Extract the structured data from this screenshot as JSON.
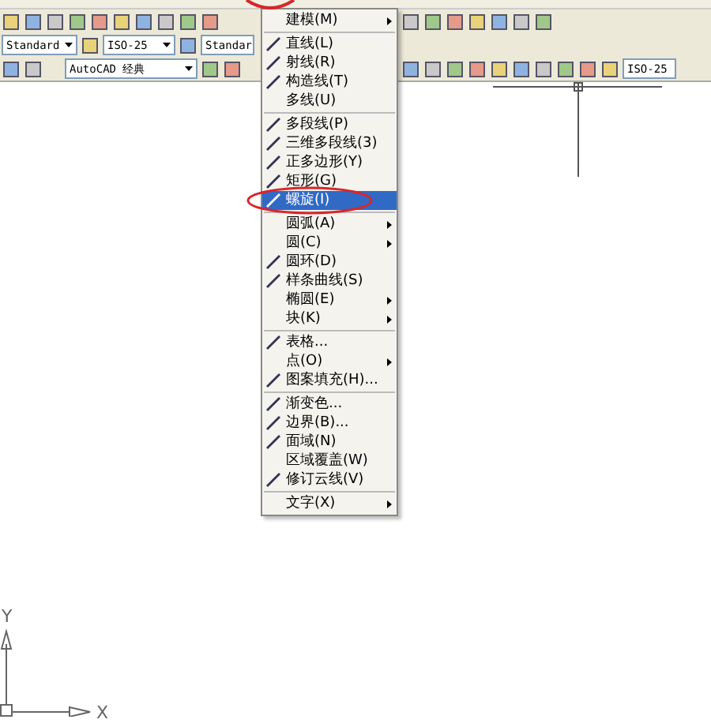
{
  "toolbars": {
    "style_combos": [
      {
        "value": "Standard"
      },
      {
        "value": "ISO-25"
      },
      {
        "value": "Standar"
      }
    ],
    "workspace_combo": {
      "value": "AutoCAD 经典"
    },
    "dimstyle_combo": {
      "value": "ISO-25"
    }
  },
  "draw_menu": {
    "items": [
      {
        "kind": "item",
        "label": "建模(M)",
        "submenu": true,
        "icon": false,
        "selected": false
      },
      {
        "kind": "separator"
      },
      {
        "kind": "item",
        "label": "直线(L)",
        "submenu": false,
        "icon": true,
        "selected": false
      },
      {
        "kind": "item",
        "label": "射线(R)",
        "submenu": false,
        "icon": true,
        "selected": false
      },
      {
        "kind": "item",
        "label": "构造线(T)",
        "submenu": false,
        "icon": true,
        "selected": false
      },
      {
        "kind": "item",
        "label": "多线(U)",
        "submenu": false,
        "icon": false,
        "selected": false
      },
      {
        "kind": "separator"
      },
      {
        "kind": "item",
        "label": "多段线(P)",
        "submenu": false,
        "icon": true,
        "selected": false
      },
      {
        "kind": "item",
        "label": "三维多段线(3)",
        "submenu": false,
        "icon": true,
        "selected": false
      },
      {
        "kind": "item",
        "label": "正多边形(Y)",
        "submenu": false,
        "icon": true,
        "selected": false
      },
      {
        "kind": "item",
        "label": "矩形(G)",
        "submenu": false,
        "icon": true,
        "selected": false
      },
      {
        "kind": "item",
        "label": "螺旋(I)",
        "submenu": false,
        "icon": true,
        "selected": true
      },
      {
        "kind": "separator"
      },
      {
        "kind": "item",
        "label": "圆弧(A)",
        "submenu": true,
        "icon": false,
        "selected": false
      },
      {
        "kind": "item",
        "label": "圆(C)",
        "submenu": true,
        "icon": false,
        "selected": false
      },
      {
        "kind": "item",
        "label": "圆环(D)",
        "submenu": false,
        "icon": true,
        "selected": false
      },
      {
        "kind": "item",
        "label": "样条曲线(S)",
        "submenu": false,
        "icon": true,
        "selected": false
      },
      {
        "kind": "item",
        "label": "椭圆(E)",
        "submenu": true,
        "icon": false,
        "selected": false
      },
      {
        "kind": "item",
        "label": "块(K)",
        "submenu": true,
        "icon": false,
        "selected": false
      },
      {
        "kind": "separator"
      },
      {
        "kind": "item",
        "label": "表格...",
        "submenu": false,
        "icon": true,
        "selected": false
      },
      {
        "kind": "item",
        "label": "点(O)",
        "submenu": true,
        "icon": false,
        "selected": false
      },
      {
        "kind": "item",
        "label": "图案填充(H)...",
        "submenu": false,
        "icon": true,
        "selected": false
      },
      {
        "kind": "separator"
      },
      {
        "kind": "item",
        "label": "渐变色...",
        "submenu": false,
        "icon": true,
        "selected": false
      },
      {
        "kind": "item",
        "label": "边界(B)...",
        "submenu": false,
        "icon": true,
        "selected": false
      },
      {
        "kind": "item",
        "label": "面域(N)",
        "submenu": false,
        "icon": true,
        "selected": false
      },
      {
        "kind": "item",
        "label": "区域覆盖(W)",
        "submenu": false,
        "icon": false,
        "selected": false
      },
      {
        "kind": "item",
        "label": "修订云线(V)",
        "submenu": false,
        "icon": true,
        "selected": false
      },
      {
        "kind": "separator"
      },
      {
        "kind": "item",
        "label": "文字(X)",
        "submenu": true,
        "icon": false,
        "selected": false
      }
    ]
  },
  "ucs": {
    "y_label": "Y",
    "x_label": "X"
  }
}
